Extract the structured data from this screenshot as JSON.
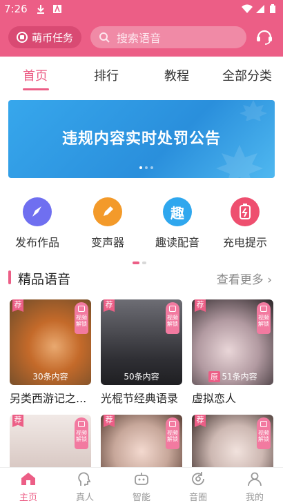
{
  "status": {
    "time": "7:26"
  },
  "header": {
    "task_label": "萌币任务",
    "search_placeholder": "搜索语音"
  },
  "tabs": [
    {
      "label": "首页",
      "active": true
    },
    {
      "label": "排行",
      "active": false
    },
    {
      "label": "教程",
      "active": false
    },
    {
      "label": "全部分类",
      "active": false
    }
  ],
  "banner": {
    "text": "违规内容实时处罚公告"
  },
  "quick_actions": [
    {
      "label": "发布作品",
      "icon": "rocket-icon",
      "color": "#6f6ff0"
    },
    {
      "label": "变声器",
      "icon": "pencil-icon",
      "color": "#f39a2a"
    },
    {
      "label": "趣读配音",
      "icon": "qu-icon",
      "glyph": "趣",
      "color": "#2fa7ee"
    },
    {
      "label": "充电提示",
      "icon": "battery-icon",
      "color": "#ee4f6f"
    }
  ],
  "section": {
    "title": "精品语音",
    "more": "查看更多"
  },
  "cards": [
    {
      "name": "另类西游记之...",
      "count": "30条内容",
      "rec": "荐",
      "badge": "视频\n解锁",
      "bg": "#c46a2a",
      "origin": ""
    },
    {
      "name": "光棍节经典语录",
      "count": "50条内容",
      "rec": "荐",
      "badge": "视频\n解锁",
      "bg": "#4a4a52",
      "origin": ""
    },
    {
      "name": "虚拟恋人",
      "count": "51条内容",
      "rec": "荐",
      "badge": "视频\n解锁",
      "bg": "#8a7a82",
      "origin": "原"
    }
  ],
  "cards_row2": [
    {
      "rec": "荐",
      "badge": "视频\n解锁",
      "bg": "#e9dedc"
    },
    {
      "rec": "荐",
      "badge": "视频\n解锁",
      "bg": "#c7b3aa"
    },
    {
      "rec": "荐",
      "badge": "视频\n解锁",
      "bg": "#e7dcd8"
    }
  ],
  "bottom_nav": [
    {
      "label": "主页",
      "icon": "home-icon",
      "active": true
    },
    {
      "label": "真人",
      "icon": "person-head-icon",
      "active": false
    },
    {
      "label": "智能",
      "icon": "robot-icon",
      "active": false
    },
    {
      "label": "音圈",
      "icon": "circle-refresh-icon",
      "active": false
    },
    {
      "label": "我的",
      "icon": "user-icon",
      "active": false
    }
  ],
  "colors": {
    "brand": "#ec5e86",
    "banner": "#2a8fdc"
  }
}
